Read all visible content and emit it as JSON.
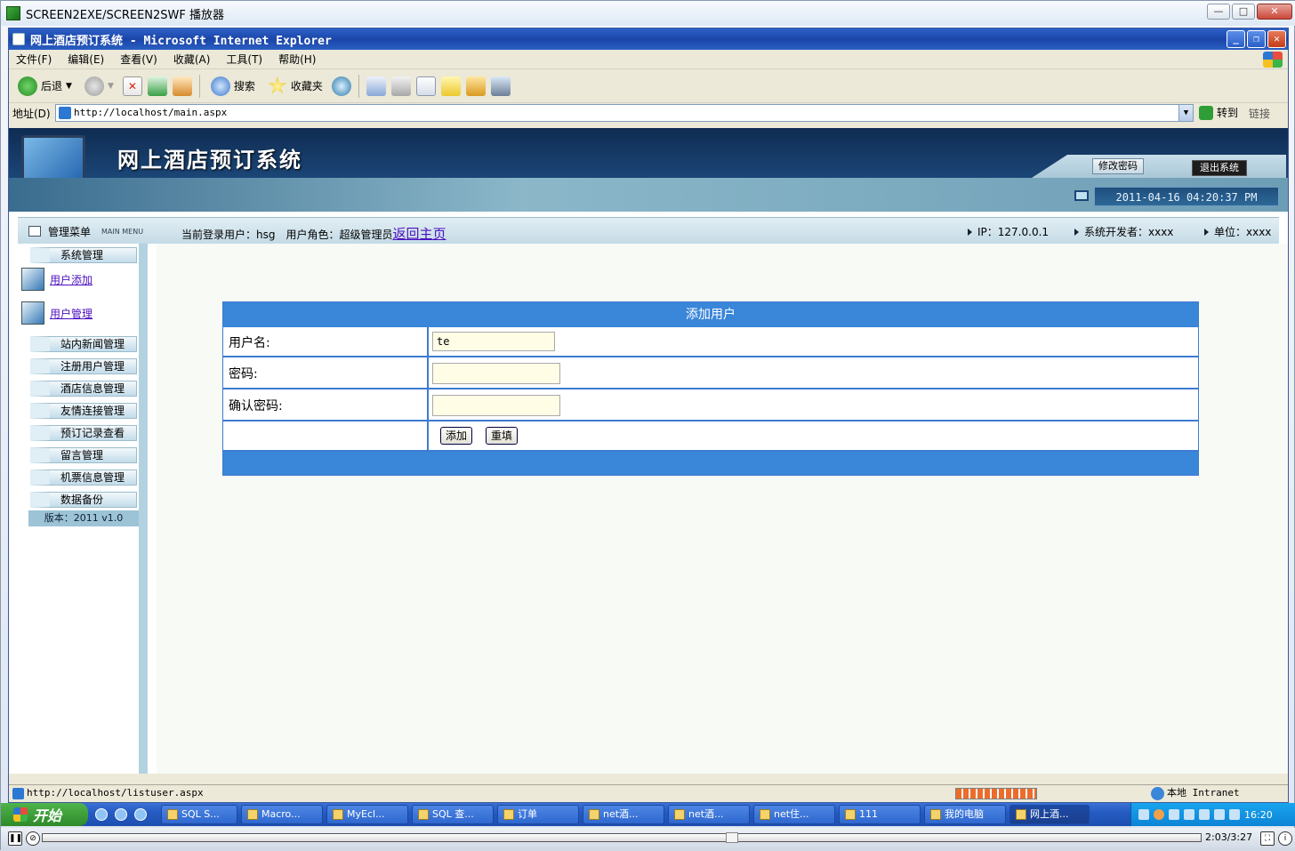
{
  "player": {
    "title": "SCREEN2EXE/SCREEN2SWF 播放器",
    "time": "2:03/3:27",
    "progress": 0.596
  },
  "ie": {
    "title": "网上酒店预订系统 - Microsoft Internet Explorer",
    "menu": [
      "文件(F)",
      "编辑(E)",
      "查看(V)",
      "收藏(A)",
      "工具(T)",
      "帮助(H)"
    ],
    "toolbar": {
      "back": "后退",
      "search": "搜索",
      "favorites": "收藏夹"
    },
    "address_label": "地址(D)",
    "address": "http://localhost/main.aspx",
    "go": "转到",
    "links": "链接",
    "status_url": "http://localhost/listuser.aspx",
    "zone": "本地 Intranet"
  },
  "page": {
    "title": "网上酒店预订系统",
    "change_password": "修改密码",
    "logout": "退出系统",
    "datetime": "2011-04-16 04:20:37 PM",
    "menu_title": "管理菜单",
    "menu_sub": "MAIN MENU",
    "user_info": "当前登录用户：hsg　用户角色：超级管理员",
    "home_link": "返回主页",
    "ip": "IP：127.0.0.1",
    "developer": "系统开发者：xxxx",
    "unit": "单位：xxxx",
    "sidebar": {
      "system": "系统管理",
      "user_add": "用户添加",
      "user_manage": "用户管理",
      "items": [
        "站内新闻管理",
        "注册用户管理",
        "酒店信息管理",
        "友情连接管理",
        "预订记录查看",
        "留言管理",
        "机票信息管理",
        "数据备份"
      ],
      "version": "版本：2011 v1.0"
    },
    "form": {
      "title": "添加用户",
      "username_label": "用户名:",
      "username_value": "te",
      "password_label": "密码:",
      "password_value": "",
      "confirm_label": "确认密码:",
      "confirm_value": "",
      "add_btn": "添加",
      "reset_btn": "重填"
    }
  },
  "taskbar": {
    "start": "开始",
    "tasks": [
      "SQL S...",
      "Macro...",
      "MyEcl...",
      "SQL 查...",
      "订单",
      "net酒...",
      "net酒...",
      "net住...",
      "111",
      "我的电脑",
      "网上酒..."
    ],
    "clock": "16:20"
  }
}
